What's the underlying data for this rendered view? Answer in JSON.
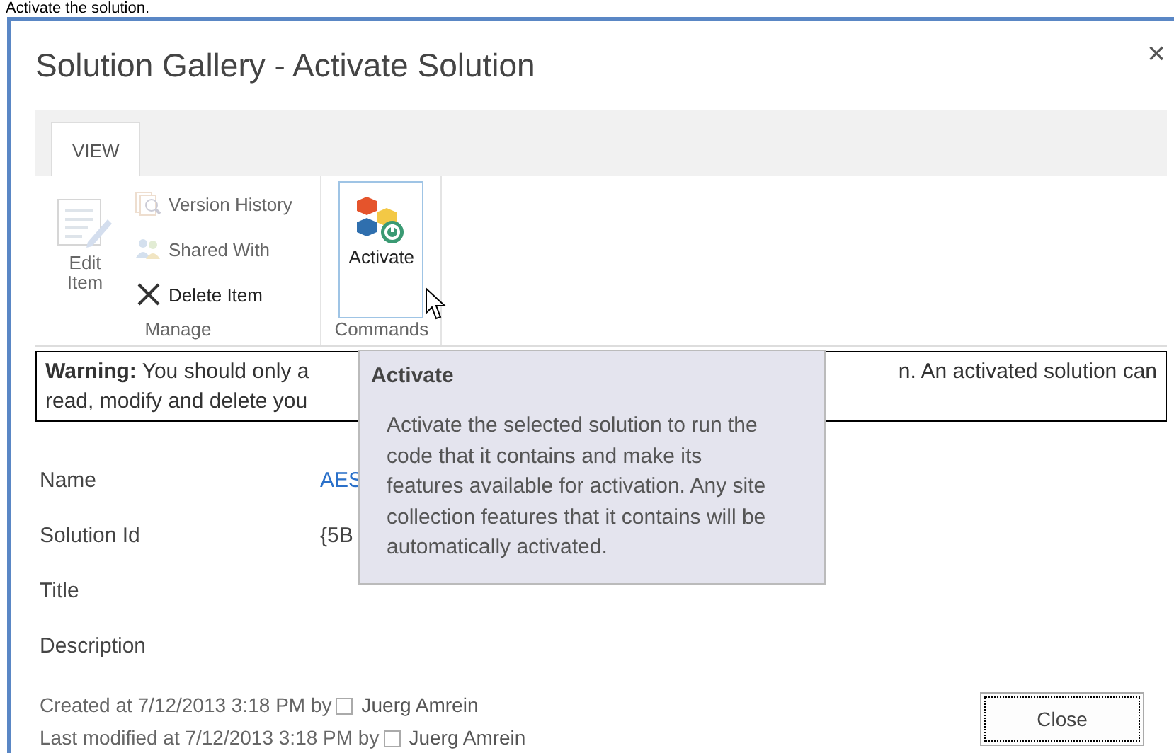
{
  "caption": "Activate the solution.",
  "dialog": {
    "title": "Solution Gallery - Activate Solution",
    "close_glyph": "×"
  },
  "ribbon": {
    "tabs": [
      {
        "label": "VIEW",
        "selected": true
      }
    ],
    "groups": [
      {
        "label": "Manage",
        "buttons": [
          {
            "kind": "edit",
            "label": "Edit Item",
            "disabled": true
          },
          {
            "kind": "history",
            "label": "Version History",
            "disabled": true
          },
          {
            "kind": "share",
            "label": "Shared With",
            "disabled": true
          },
          {
            "kind": "delete",
            "label": "Delete Item",
            "disabled": false
          }
        ]
      },
      {
        "label": "Commands",
        "buttons": [
          {
            "kind": "activate",
            "label": "Activate",
            "disabled": false,
            "hovered": true
          }
        ]
      }
    ]
  },
  "warning": {
    "label": "Warning:",
    "line1_start": "You should only a",
    "line1_end": "n. An activated solution can",
    "line2": "read, modify and delete you"
  },
  "tooltip": {
    "title": "Activate",
    "text": "Activate the selected solution to run the code that it contains and make its features available for activation.  Any site collection features that it contains will be automatically activated."
  },
  "fields": [
    {
      "label": "Name",
      "value": "AES",
      "kind": "link"
    },
    {
      "label": "Solution Id",
      "value": "{5B",
      "kind": "text"
    },
    {
      "label": "Title"
    },
    {
      "label": "Description"
    }
  ],
  "footer": [
    {
      "text": "Created at 7/12/2013 3:18 PM by",
      "user": "Juerg Amrein"
    },
    {
      "text": "Last modified at 7/12/2013 3:18 PM by",
      "user": "Juerg Amrein"
    }
  ],
  "close_button": {
    "label": "Close",
    "focused": true
  }
}
